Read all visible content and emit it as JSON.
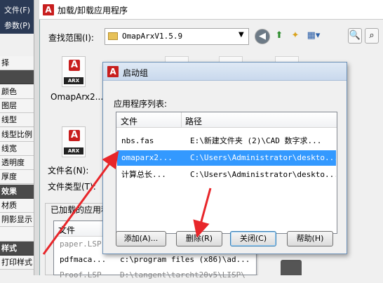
{
  "left_panel": {
    "menu_items": [
      "文件(F)",
      "参数(P)"
    ],
    "rows": [
      {
        "label": "择",
        "section": false
      },
      {
        "label": "",
        "section": true
      },
      {
        "label": "颜色",
        "section": false
      },
      {
        "label": "图层",
        "section": false
      },
      {
        "label": "线型",
        "section": false
      },
      {
        "label": "线型比例",
        "section": false
      },
      {
        "label": "线宽",
        "section": false
      },
      {
        "label": "透明度",
        "section": false
      },
      {
        "label": "厚度",
        "section": false
      },
      {
        "label": "效果",
        "section": true
      },
      {
        "label": "材质",
        "section": false
      },
      {
        "label": "阴影显示",
        "section": false
      },
      {
        "label": "",
        "section": false
      },
      {
        "label": "样式",
        "section": true
      },
      {
        "label": "打印样式",
        "section": false
      }
    ]
  },
  "load_dialog": {
    "title": "加载/卸载应用程序",
    "look_in_label": "查找范围(I):",
    "look_in_value": "OmapArxV1.5.9",
    "files": [
      {
        "name": "OmapArx2...",
        "badge": "ARX"
      },
      {
        "name": "",
        "badge": "ARX"
      }
    ],
    "filename_label": "文件名(N):",
    "filetype_label": "文件类型(T):",
    "loaded_label": "已加载的应用程序",
    "loaded_header": "文件",
    "loaded_rows": [
      {
        "file": "paper.LSP",
        "path": ""
      },
      {
        "file": "pdfmaca...",
        "path": "c:\\program files (x86)\\ad..."
      },
      {
        "file": "Proof.LSP",
        "path": "D:\\tangent\\tarcht20v5\\LISP\\"
      }
    ]
  },
  "startup_dialog": {
    "title": "启动组",
    "list_label": "应用程序列表:",
    "columns": [
      "文件",
      "路径"
    ],
    "rows": [
      {
        "file": "nbs.fas",
        "path": "E:\\新建文件夹 (2)\\CAD 数字求...",
        "selected": false
      },
      {
        "file": "omaparx2...",
        "path": "C:\\Users\\Administrator\\deskto...",
        "selected": true
      },
      {
        "file": "计算总长...",
        "path": "C:\\Users\\Administrator\\deskto...",
        "selected": false
      }
    ],
    "buttons": {
      "add": "添加(A)...",
      "remove": "删除(R)",
      "close": "关闭(C)",
      "help": "帮助(H)"
    }
  },
  "colors": {
    "selection": "#3399ff",
    "annotation_arrow": "#e8262a",
    "cad_red": "#c81e1e"
  }
}
